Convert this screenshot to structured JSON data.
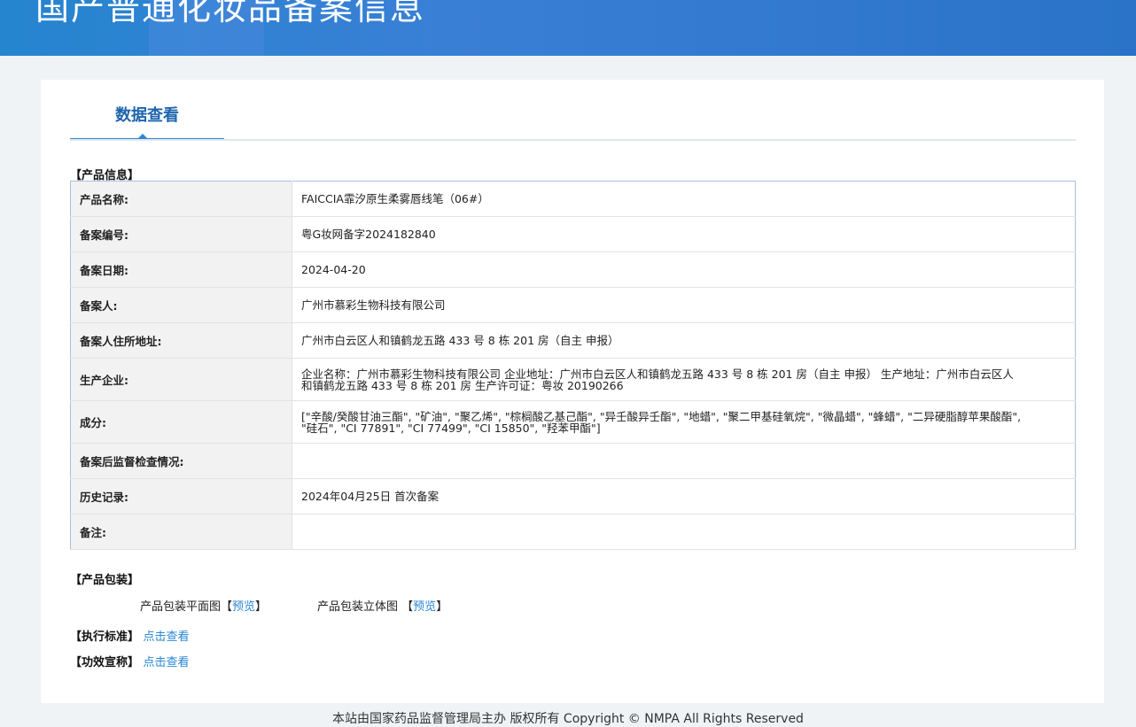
{
  "header": {
    "title": "国产普通化妆品备案信息"
  },
  "tab": {
    "label": "数据查看"
  },
  "sections": {
    "product_info": "【产品信息】",
    "packaging": "【产品包装】",
    "standard": "【执行标准】",
    "efficacy": "【功效宣称】"
  },
  "rows": [
    {
      "label": "产品名称:",
      "value": "FAICCIA霏汐原生柔雾唇线笔（06#）"
    },
    {
      "label": "备案编号:",
      "value": "粤G妆网备字2024182840"
    },
    {
      "label": "备案日期:",
      "value": "2024-04-20"
    },
    {
      "label": "备案人:",
      "value": "广州市慕彩生物科技有限公司"
    },
    {
      "label": "备案人住所地址:",
      "value": "广州市白云区人和镇鹤龙五路 433 号 8 栋 201 房（自主 申报）"
    },
    {
      "label": "生产企业:",
      "value": "企业名称：广州市慕彩生物科技有限公司 企业地址：广州市白云区人和镇鹤龙五路 433 号 8 栋 201 房（自主 申报） 生产地址：广州市白云区人和镇鹤龙五路 433 号 8 栋 201 房 生产许可证：粤妆 20190266"
    },
    {
      "label": "成分:",
      "value": "[\"辛酸/癸酸甘油三酯\", \"矿油\", \"聚乙烯\", \"棕榈酸乙基己酯\", \"异壬酸异壬酯\", \"地蜡\", \"聚二甲基硅氧烷\", \"微晶蜡\", \"蜂蜡\", \"二异硬脂醇苹果酸酯\", \"硅石\", \"CI 77891\", \"CI 77499\", \"CI 15850\", \"羟苯甲酯\"]"
    },
    {
      "label": "备案后监督检查情况:",
      "value": ""
    },
    {
      "label": "历史记录:",
      "value": "2024年04月25日 首次备案"
    },
    {
      "label": "备注:",
      "value": ""
    }
  ],
  "packaging": {
    "flat_label": "产品包装平面图",
    "solid_label": "产品包装立体图",
    "bracket_open": "【",
    "bracket_close": "】",
    "preview": "预览"
  },
  "links": {
    "view": "点击查看"
  },
  "footer": {
    "text": "本站由国家药品监督管理局主办 版权所有 Copyright © NMPA All Rights Reserved"
  }
}
